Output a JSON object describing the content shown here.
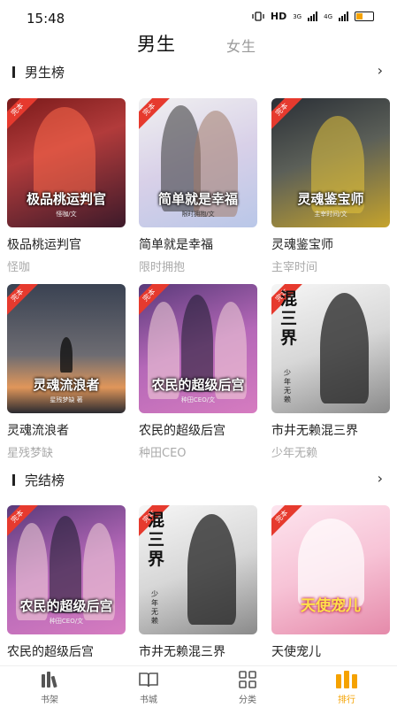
{
  "status": {
    "time": "15:48",
    "network_label": "HD",
    "net1": "3G",
    "net2": "4G"
  },
  "tabs": {
    "active": "男生",
    "inactive": "女生"
  },
  "sections": [
    {
      "title": "男生榜",
      "arrow": "›",
      "books": [
        {
          "cover_title": "极品桃运判官",
          "cover_author": "怪咖/文",
          "title": "极品桃运判官",
          "author": "怪咖"
        },
        {
          "cover_title": "简单就是幸福",
          "cover_author": "限时拥抱/文",
          "title": "简单就是幸福",
          "author": "限时拥抱"
        },
        {
          "cover_title": "灵魂鉴宝师",
          "cover_author": "主宰时间/文",
          "title": "灵魂鉴宝师",
          "author": "主宰时间"
        },
        {
          "cover_title": "灵魂流浪者",
          "cover_author": "星残梦缺 著",
          "title": "灵魂流浪者",
          "author": "星残梦缺"
        },
        {
          "cover_title": "农民的超级后宫",
          "cover_author": "种田CEO/文",
          "title": "农民的超级后宫",
          "author": "种田CEO"
        },
        {
          "cover_title": "混三界",
          "cover_author": "少年无赖",
          "title": "市井无赖混三界",
          "author": "少年无赖"
        }
      ]
    },
    {
      "title": "完结榜",
      "arrow": "›",
      "books": [
        {
          "cover_title": "农民的超级后宫",
          "cover_author": "种田CEO/文",
          "title": "农民的超级后宫",
          "author": ""
        },
        {
          "cover_title": "混三界",
          "cover_author": "少年无赖",
          "title": "市井无赖混三界",
          "author": ""
        },
        {
          "cover_title": "天使宠儿",
          "cover_author": "",
          "title": "天使宠儿",
          "author": ""
        }
      ]
    }
  ],
  "ribbon_text": "完本",
  "nav": {
    "items": [
      {
        "label": "书架",
        "icon": "bookshelf-icon"
      },
      {
        "label": "书城",
        "icon": "book-open-icon"
      },
      {
        "label": "分类",
        "icon": "grid-icon"
      },
      {
        "label": "排行",
        "icon": "ranking-icon"
      }
    ],
    "active_color": "#f5a200"
  }
}
